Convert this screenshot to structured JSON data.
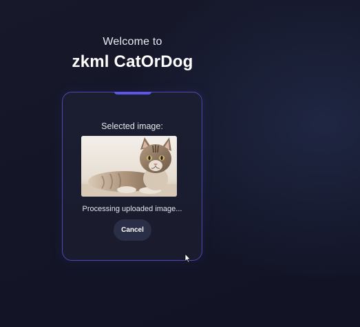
{
  "hero": {
    "welcome": "Welcome to",
    "title": "zkml CatOrDog"
  },
  "card": {
    "selected_label": "Selected image:",
    "image_alt": "cat",
    "status": "Processing uploaded image...",
    "cancel_label": "Cancel"
  },
  "colors": {
    "accent": "#5b56e6",
    "card_border": "#4b48b8",
    "button_bg": "#2b2e47",
    "page_bg": "#141628"
  },
  "icons": {
    "cursor": "mouse-pointer-icon"
  }
}
